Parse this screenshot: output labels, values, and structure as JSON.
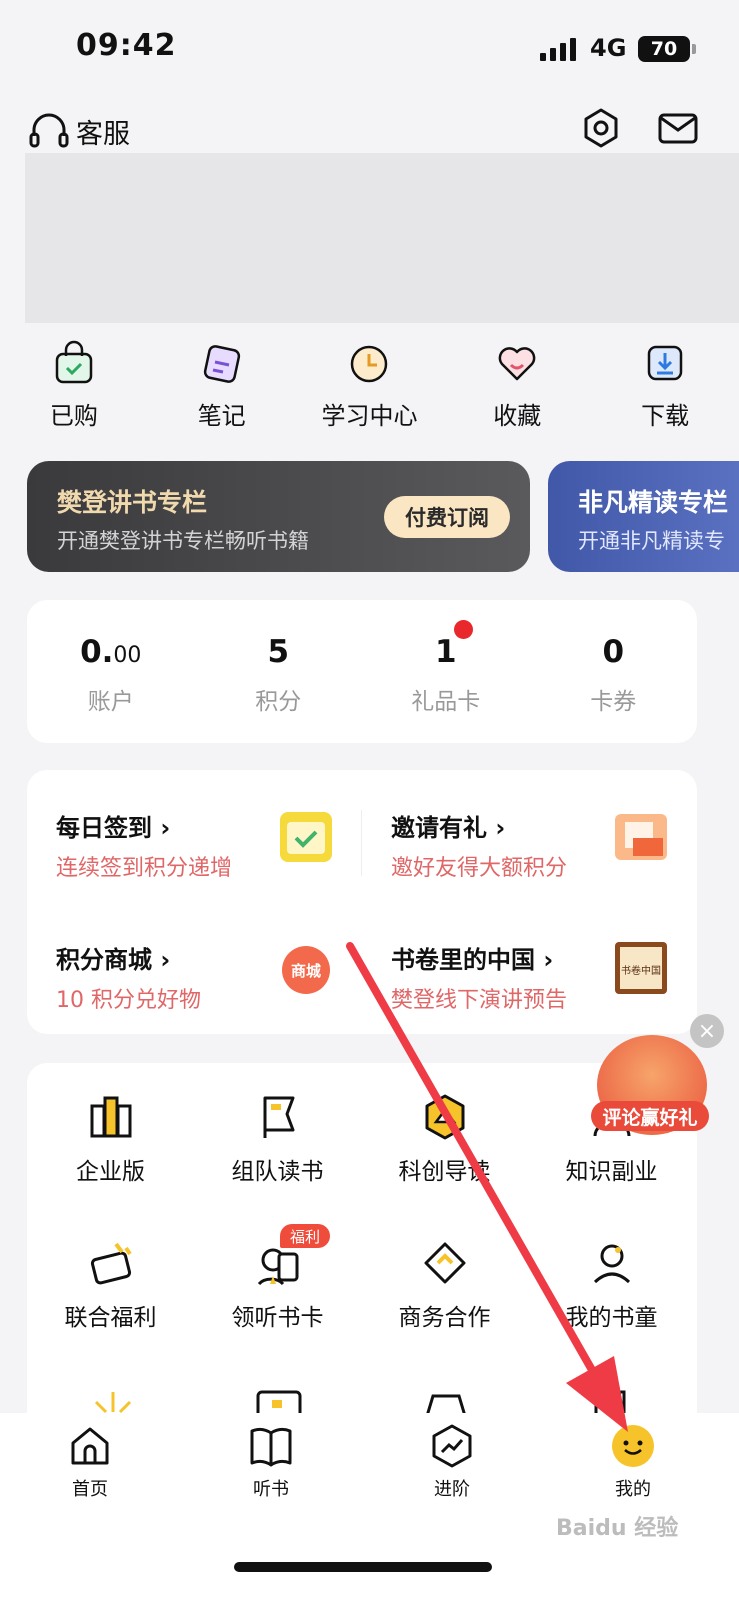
{
  "status_bar": {
    "time": "09:42",
    "network": "4G",
    "battery": "70"
  },
  "header": {
    "customer_service": "客服"
  },
  "quick_actions": [
    {
      "label": "已购",
      "icon": "shopping-bag-icon"
    },
    {
      "label": "笔记",
      "icon": "note-icon"
    },
    {
      "label": "学习中心",
      "icon": "clock-icon"
    },
    {
      "label": "收藏",
      "icon": "heart-icon"
    },
    {
      "label": "下载",
      "icon": "download-icon"
    }
  ],
  "vip_cards": [
    {
      "title": "樊登讲书专栏",
      "subtitle": "开通樊登讲书专栏畅听书籍",
      "button": "付费订阅"
    },
    {
      "title": "非凡精读专栏",
      "subtitle": "开通非凡精读专"
    }
  ],
  "wallet": [
    {
      "value_int": "0.",
      "value_dec": "00",
      "label": "账户"
    },
    {
      "value_int": "5",
      "value_dec": "",
      "label": "积分"
    },
    {
      "value_int": "1",
      "value_dec": "",
      "label": "礼品卡"
    },
    {
      "value_int": "0",
      "value_dec": "",
      "label": "卡券"
    }
  ],
  "tasks": [
    {
      "title": "每日签到",
      "subtitle": "连续签到积分递增"
    },
    {
      "title": "邀请有礼",
      "subtitle": "邀好友得大额积分"
    },
    {
      "title": "积分商城",
      "subtitle": "10 积分兑好物"
    },
    {
      "title": "书卷里的中国",
      "subtitle": "樊登线下演讲预告"
    }
  ],
  "task_images": {
    "mall_badge": "商城",
    "book_badge": "书卷中国"
  },
  "services": [
    {
      "label": "企业版"
    },
    {
      "label": "组队读书"
    },
    {
      "label": "科创导读"
    },
    {
      "label": "知识副业"
    },
    {
      "label": "联合福利"
    },
    {
      "label": "领听书卡"
    },
    {
      "label": "商务合作"
    },
    {
      "label": "我的书童"
    }
  ],
  "service_badge": "福利",
  "float_promo": {
    "label": "评论赢好礼",
    "close": "×"
  },
  "tabbar": [
    {
      "label": "首页"
    },
    {
      "label": "听书"
    },
    {
      "label": "进阶"
    },
    {
      "label": "我的"
    }
  ],
  "watermark": "Baidu 经验",
  "colors": {
    "accent_red": "#e06767",
    "vip_gold": "#f1d9ae",
    "vip_blue": "#4157a8",
    "brand_yellow": "#f6c42a"
  }
}
